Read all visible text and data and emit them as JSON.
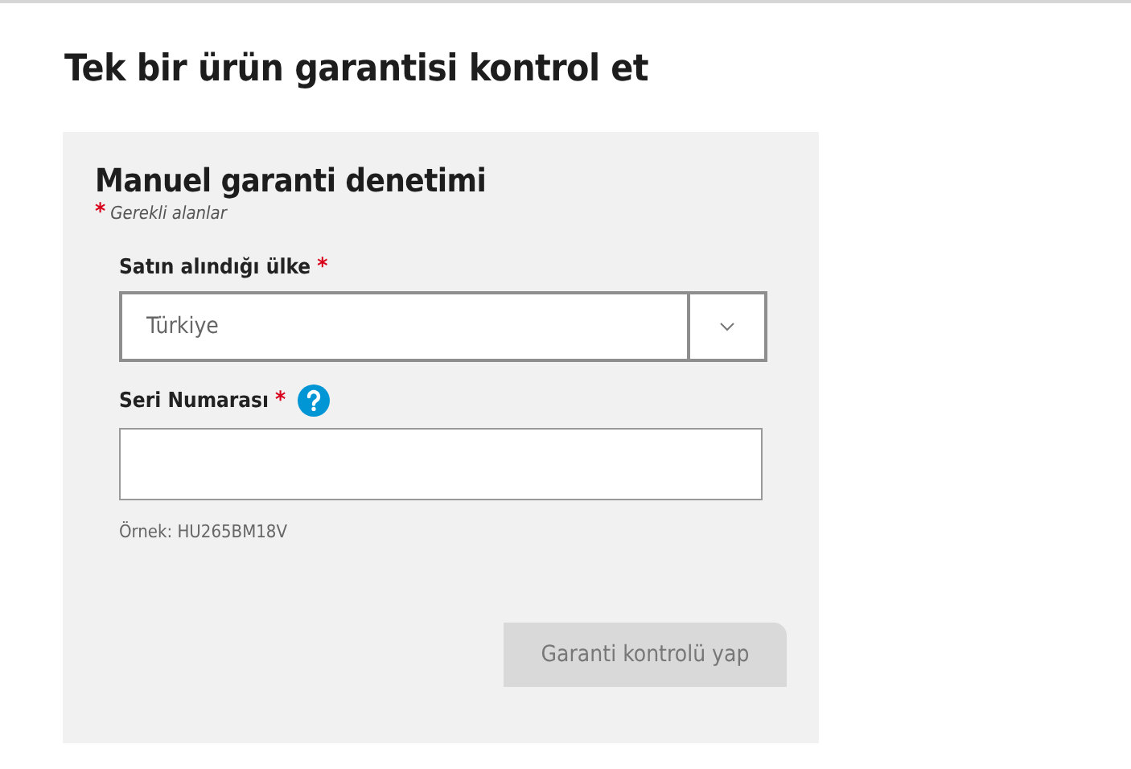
{
  "page_title": "Tek bir ürün garantisi kontrol et",
  "form": {
    "title": "Manuel garanti denetimi",
    "required_note": {
      "mark": "*",
      "text": "Gerekli alanlar"
    },
    "fields": [
      {
        "kind": "select",
        "label": "Satın alındığı ülke",
        "required_mark": "*",
        "help": false,
        "value": "Türkiye"
      },
      {
        "kind": "text",
        "label": "Seri Numarası",
        "required_mark": "*",
        "help": true,
        "hint": "Örnek: HU265BM18V"
      }
    ],
    "submit": {
      "label": "Garanti kontrolü yap",
      "disabled": true
    }
  }
}
